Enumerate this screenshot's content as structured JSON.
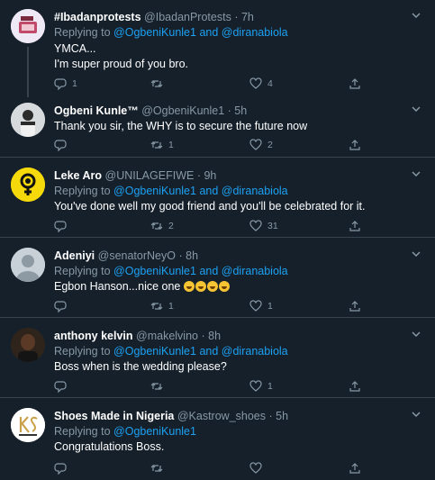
{
  "tweets": [
    {
      "name": "#Ibadanprotests",
      "handle": "@IbadanProtests",
      "time": "7h",
      "replying_label": "Replying to",
      "mention1": "@OgbeniKunle1",
      "and_label": "and",
      "mention2": "@diranabiola",
      "lines": [
        "YMCA...",
        "I'm super proud of you bro."
      ],
      "replies": "1",
      "retweets": "",
      "likes": "4",
      "avatar_colors": [
        "#e9e4f3",
        "#c14a6a"
      ]
    },
    {
      "name": "Ogbeni Kunle™",
      "handle": "@OgbeniKunle1",
      "time": "5h",
      "lines": [
        "Thank you sir, the WHY is to secure the future now"
      ],
      "replies": "",
      "retweets": "1",
      "likes": "2",
      "avatar_colors": [
        "#cfd3d6",
        "#2b2b2b"
      ]
    },
    {
      "name": "Leke Aro",
      "handle": "@UNILAGEFIWE",
      "time": "9h",
      "replying_label": "Replying to",
      "mention1": "@OgbeniKunle1",
      "and_label": "and",
      "mention2": "@diranabiola",
      "lines": [
        "You've done well my good friend and you'll be celebrated for it."
      ],
      "replies": "",
      "retweets": "2",
      "likes": "31",
      "avatar_colors": [
        "#f5d90a",
        "#111111"
      ]
    },
    {
      "name": "Adeniyi",
      "handle": "@senatorNeyO",
      "time": "8h",
      "replying_label": "Replying to",
      "mention1": "@OgbeniKunle1",
      "and_label": "and",
      "mention2": "@diranabiola",
      "lines": [
        "Egbon Hanson...nice one"
      ],
      "replies": "",
      "retweets": "1",
      "likes": "1",
      "avatar_colors": [
        "#c8d1d8",
        "#8e9aa3"
      ]
    },
    {
      "name": "anthony kelvin",
      "handle": "@makelvino",
      "time": "8h",
      "replying_label": "Replying to",
      "mention1": "@OgbeniKunle1",
      "and_label": "and",
      "mention2": "@diranabiola",
      "lines": [
        "Boss when is the wedding please?"
      ],
      "replies": "",
      "retweets": "",
      "likes": "1",
      "avatar_colors": [
        "#3a2a1e",
        "#1a1410"
      ]
    },
    {
      "name": "Shoes Made in Nigeria",
      "handle": "@Kastrow_shoes",
      "time": "5h",
      "replying_label": "Replying to",
      "mention1": "@OgbeniKunle1",
      "lines": [
        "Congratulations Boss."
      ],
      "replies": "",
      "retweets": "",
      "likes": "",
      "avatar_colors": [
        "#ffffff",
        "#c9a24b"
      ]
    }
  ],
  "icons": {
    "reply": "reply-icon",
    "retweet": "retweet-icon",
    "like": "like-icon",
    "share": "share-icon",
    "more": "chevron-down-icon"
  },
  "colors": {
    "background": "#15202b",
    "border": "#38444d",
    "muted": "#8899a6",
    "link": "#1da1f2"
  }
}
